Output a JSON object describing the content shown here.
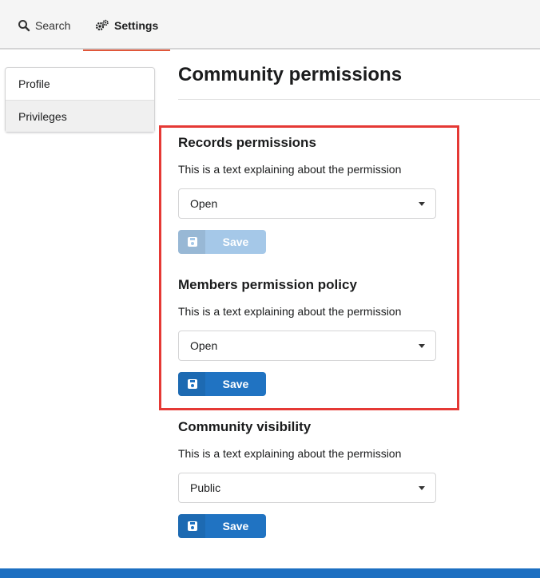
{
  "tabs": [
    {
      "label": "Search",
      "icon": "search-icon"
    },
    {
      "label": "Settings",
      "icon": "gears-icon",
      "active": true
    }
  ],
  "sidebar": {
    "items": [
      {
        "label": "Profile"
      },
      {
        "label": "Privileges",
        "active": true
      }
    ]
  },
  "page": {
    "title": "Community permissions"
  },
  "sections": [
    {
      "heading": "Records permissions",
      "description": "This is a text explaining about the permission",
      "selected": "Open",
      "save_label": "Save",
      "save_disabled": true
    },
    {
      "heading": "Members permission policy",
      "description": "This is a text explaining about the permission",
      "selected": "Open",
      "save_label": "Save",
      "save_disabled": false
    },
    {
      "heading": "Community visibility",
      "description": "This is a text explaining about the permission",
      "selected": "Public",
      "save_label": "Save",
      "save_disabled": false
    }
  ],
  "colors": {
    "primary": "#2073c2",
    "primary_disabled": "#a5c8e8",
    "highlight": "#e53935",
    "active_tab_underline": "#e0573a"
  }
}
